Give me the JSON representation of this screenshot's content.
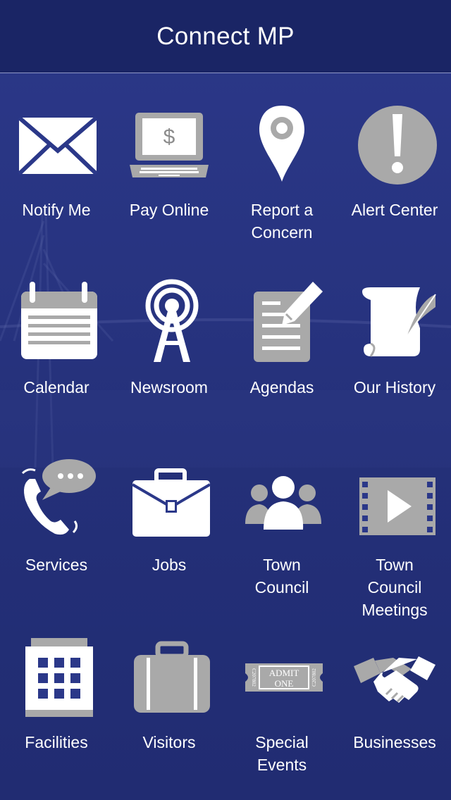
{
  "header": {
    "title": "Connect MP"
  },
  "tiles": [
    {
      "label": "Notify Me",
      "icon": "envelope-icon"
    },
    {
      "label": "Pay Online",
      "icon": "laptop-dollar-icon"
    },
    {
      "label": "Report a\nConcern",
      "icon": "map-pin-icon"
    },
    {
      "label": "Alert Center",
      "icon": "exclamation-circle-icon"
    },
    {
      "label": "Calendar",
      "icon": "calendar-icon"
    },
    {
      "label": "Newsroom",
      "icon": "broadcast-tower-icon"
    },
    {
      "label": "Agendas",
      "icon": "document-pencil-icon"
    },
    {
      "label": "Our History",
      "icon": "scroll-quill-icon"
    },
    {
      "label": "Services",
      "icon": "phone-chat-icon"
    },
    {
      "label": "Jobs",
      "icon": "briefcase-icon"
    },
    {
      "label": "Town\nCouncil",
      "icon": "group-people-icon"
    },
    {
      "label": "Town\nCouncil\nMeetings",
      "icon": "film-play-icon"
    },
    {
      "label": "Facilities",
      "icon": "building-icon"
    },
    {
      "label": "Visitors",
      "icon": "suitcase-icon"
    },
    {
      "label": "Special\nEvents",
      "icon": "admit-ticket-icon"
    },
    {
      "label": "Businesses",
      "icon": "handshake-icon"
    }
  ],
  "ticket": {
    "line1": "ADMIT",
    "line2": "ONE",
    "serial": "C207802"
  },
  "colors": {
    "header": "#1a2565",
    "background": "#2b3889",
    "icon_gray": "#a9a9a9",
    "icon_white": "#ffffff"
  }
}
